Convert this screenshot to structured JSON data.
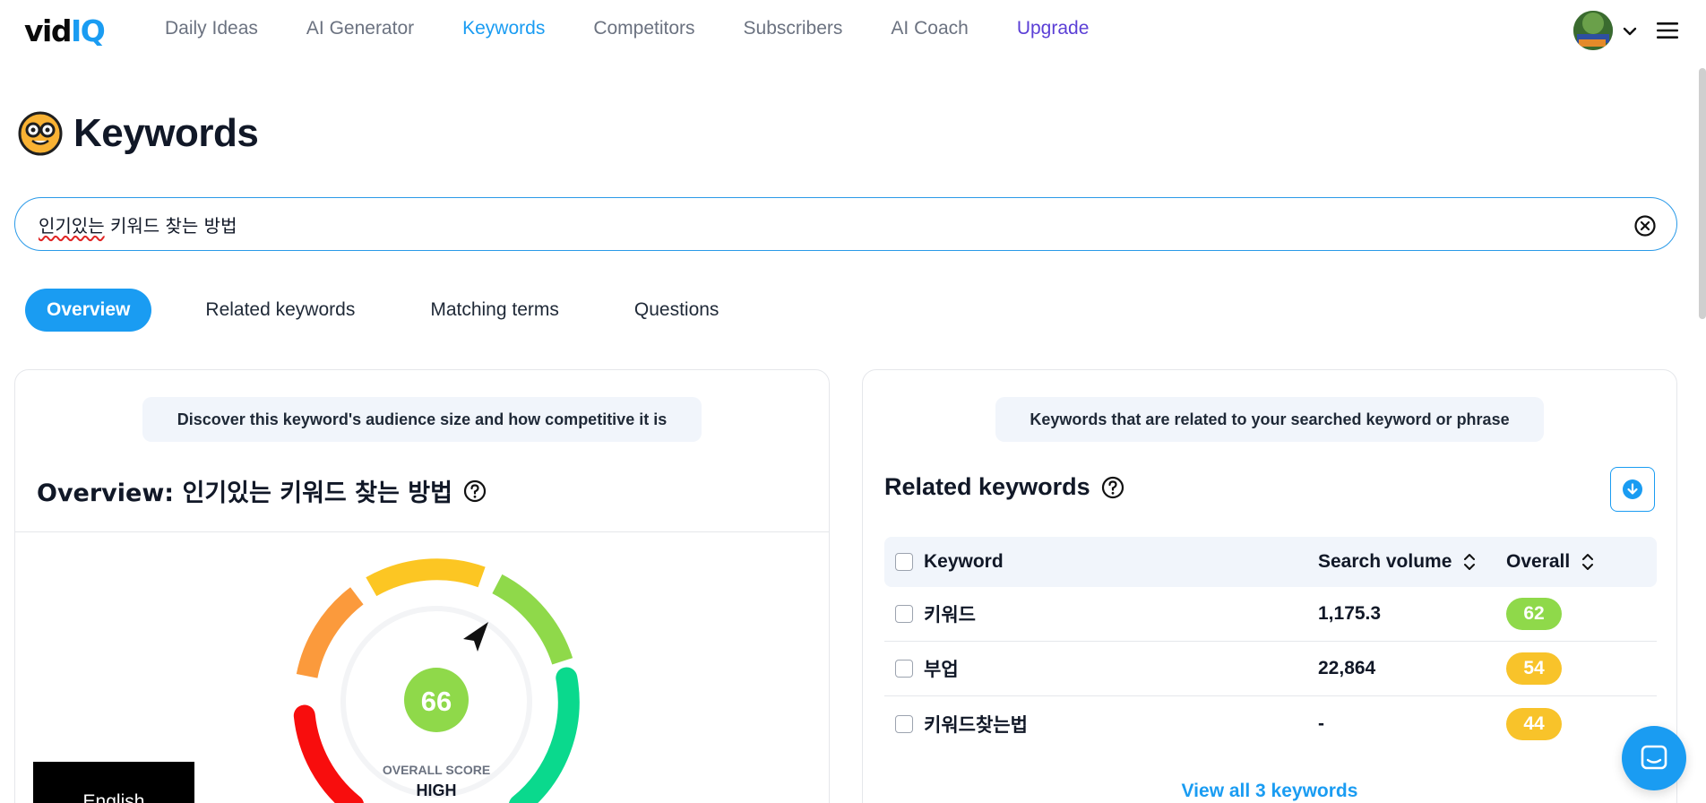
{
  "brand": {
    "logo_left": "vid",
    "logo_right": "IQ"
  },
  "nav": {
    "items": [
      {
        "label": "Daily Ideas"
      },
      {
        "label": "AI Generator"
      },
      {
        "label": "Keywords"
      },
      {
        "label": "Competitors"
      },
      {
        "label": "Subscribers"
      },
      {
        "label": "AI Coach"
      },
      {
        "label": "Upgrade"
      }
    ],
    "active": "Keywords"
  },
  "page": {
    "title": "Keywords"
  },
  "search": {
    "query_misspelled": "인기있는",
    "query_rest": " 키워드 찾는 방법"
  },
  "tabs": [
    {
      "label": "Overview"
    },
    {
      "label": "Related keywords"
    },
    {
      "label": "Matching terms"
    },
    {
      "label": "Questions"
    }
  ],
  "overview": {
    "hint": "Discover this keyword's audience size and how competitive it is",
    "title": "Overview: 인기있는 키워드 찾는 방법",
    "score": "66",
    "score_caption": "OVERALL SCORE",
    "score_rating": "HIGH"
  },
  "related": {
    "hint": "Keywords that are related to your searched keyword or phrase",
    "title": "Related keywords",
    "columns": {
      "keyword": "Keyword",
      "search_volume": "Search volume",
      "overall": "Overall"
    },
    "rows": [
      {
        "keyword": "키워드",
        "volume": "1,175.3",
        "overall": "62",
        "color": "#8fd94a"
      },
      {
        "keyword": "부업",
        "volume": "22,864",
        "overall": "54",
        "color": "#f8c32a"
      },
      {
        "keyword": "키워드찾는법",
        "volume": "-",
        "overall": "44",
        "color": "#f8c32a"
      }
    ],
    "view_all": "View all 3 keywords"
  },
  "language": {
    "label": "English"
  },
  "colors": {
    "accent": "#1a9cf2",
    "upgrade": "#5b3fd6",
    "score_green": "#8fd94a"
  }
}
